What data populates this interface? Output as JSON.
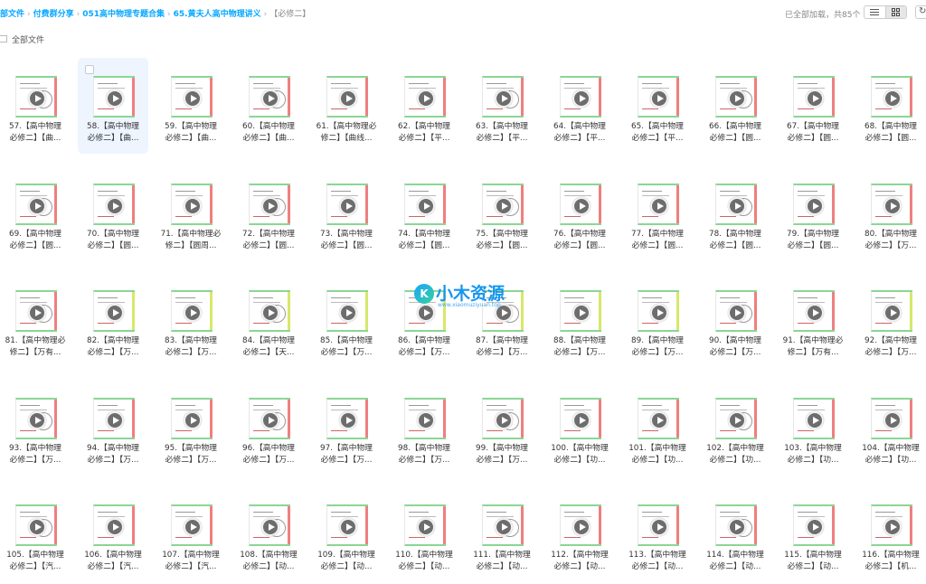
{
  "breadcrumb": {
    "items": [
      "部文件",
      "付费群分享",
      "051高中物理专题合集",
      "65.黄夫人高中物理讲义"
    ],
    "current": "【必修二】"
  },
  "status": {
    "loaded_text": "已全部加载，共85个"
  },
  "view": {
    "list_icon": "list-view-icon",
    "grid_icon": "grid-view-icon",
    "refresh_icon": "refresh-icon"
  },
  "all_files": {
    "label": "全部文件"
  },
  "watermark": {
    "title": "小木资源",
    "url": "www.xiaomuziyuan.top",
    "badge": "K"
  },
  "colors": {
    "accent": "#06a7ff",
    "thumb_border": "#8ad694",
    "thumb_edge": "#ef7f7f"
  },
  "files": [
    {
      "line1": "57.【高中物理",
      "line2": "必修二】【曲..."
    },
    {
      "line1": "58.【高中物理",
      "line2": "必修二】【曲..."
    },
    {
      "line1": "59.【高中物理",
      "line2": "必修二】【曲..."
    },
    {
      "line1": "60.【高中物理",
      "line2": "必修二】【曲..."
    },
    {
      "line1": "61.【高中物理必",
      "line2": "修二】【曲线..."
    },
    {
      "line1": "62.【高中物理",
      "line2": "必修二】【平..."
    },
    {
      "line1": "63.【高中物理",
      "line2": "必修二】【平..."
    },
    {
      "line1": "64.【高中物理",
      "line2": "必修二】【平..."
    },
    {
      "line1": "65.【高中物理",
      "line2": "必修二】【平..."
    },
    {
      "line1": "66.【高中物理",
      "line2": "必修二】【圆..."
    },
    {
      "line1": "67.【高中物理",
      "line2": "必修二】【圆..."
    },
    {
      "line1": "68.【高中物理",
      "line2": "必修二】【圆..."
    },
    {
      "line1": "69.【高中物理",
      "line2": "必修二】【圆..."
    },
    {
      "line1": "70.【高中物理",
      "line2": "必修二】【圆..."
    },
    {
      "line1": "71.【高中物理必",
      "line2": "修二】【圆周..."
    },
    {
      "line1": "72.【高中物理",
      "line2": "必修二】【圆..."
    },
    {
      "line1": "73.【高中物理",
      "line2": "必修二】【圆..."
    },
    {
      "line1": "74.【高中物理",
      "line2": "必修二】【圆..."
    },
    {
      "line1": "75.【高中物理",
      "line2": "必修二】【圆..."
    },
    {
      "line1": "76.【高中物理",
      "line2": "必修二】【圆..."
    },
    {
      "line1": "77.【高中物理",
      "line2": "必修二】【圆..."
    },
    {
      "line1": "78.【高中物理",
      "line2": "必修二】【圆..."
    },
    {
      "line1": "79.【高中物理",
      "line2": "必修二】【圆..."
    },
    {
      "line1": "80.【高中物理",
      "line2": "必修二】【万..."
    },
    {
      "line1": "81.【高中物理必",
      "line2": "修二】【万有..."
    },
    {
      "line1": "82.【高中物理",
      "line2": "必修二】【万..."
    },
    {
      "line1": "83.【高中物理",
      "line2": "必修二】【万..."
    },
    {
      "line1": "84.【高中物理",
      "line2": "必修二】【天..."
    },
    {
      "line1": "85.【高中物理",
      "line2": "必修二】【万..."
    },
    {
      "line1": "86.【高中物理",
      "line2": "必修二】【万..."
    },
    {
      "line1": "87.【高中物理",
      "line2": "必修二】【万..."
    },
    {
      "line1": "88.【高中物理",
      "line2": "必修二】【万..."
    },
    {
      "line1": "89.【高中物理",
      "line2": "必修二】【万..."
    },
    {
      "line1": "90.【高中物理",
      "line2": "必修二】【万..."
    },
    {
      "line1": "91.【高中物理必",
      "line2": "修二】【万有..."
    },
    {
      "line1": "92.【高中物理",
      "line2": "必修二】【万..."
    },
    {
      "line1": "93.【高中物理",
      "line2": "必修二】【万..."
    },
    {
      "line1": "94.【高中物理",
      "line2": "必修二】【万..."
    },
    {
      "line1": "95.【高中物理",
      "line2": "必修二】【万..."
    },
    {
      "line1": "96.【高中物理",
      "line2": "必修二】【万..."
    },
    {
      "line1": "97.【高中物理",
      "line2": "必修二】【万..."
    },
    {
      "line1": "98.【高中物理",
      "line2": "必修二】【万..."
    },
    {
      "line1": "99.【高中物理",
      "line2": "必修二】【万..."
    },
    {
      "line1": "100.【高中物理",
      "line2": "必修二】【功..."
    },
    {
      "line1": "101.【高中物理",
      "line2": "必修二】【功..."
    },
    {
      "line1": "102.【高中物理",
      "line2": "必修二】【功..."
    },
    {
      "line1": "103.【高中物理",
      "line2": "必修二】【功..."
    },
    {
      "line1": "104.【高中物理",
      "line2": "必修二】【功..."
    },
    {
      "line1": "105.【高中物理",
      "line2": "必修二】【汽..."
    },
    {
      "line1": "106.【高中物理",
      "line2": "必修二】【汽..."
    },
    {
      "line1": "107.【高中物理",
      "line2": "必修二】【汽..."
    },
    {
      "line1": "108.【高中物理",
      "line2": "必修二】【动..."
    },
    {
      "line1": "109.【高中物理",
      "line2": "必修二】【动..."
    },
    {
      "line1": "110.【高中物理",
      "line2": "必修二】【动..."
    },
    {
      "line1": "111.【高中物理",
      "line2": "必修二】【动..."
    },
    {
      "line1": "112.【高中物理",
      "line2": "必修二】【动..."
    },
    {
      "line1": "113.【高中物理",
      "line2": "必修二】【动..."
    },
    {
      "line1": "114.【高中物理",
      "line2": "必修二】【动..."
    },
    {
      "line1": "115.【高中物理",
      "line2": "必修二】【动..."
    },
    {
      "line1": "116.【高中物理",
      "line2": "必修二】【机..."
    }
  ]
}
